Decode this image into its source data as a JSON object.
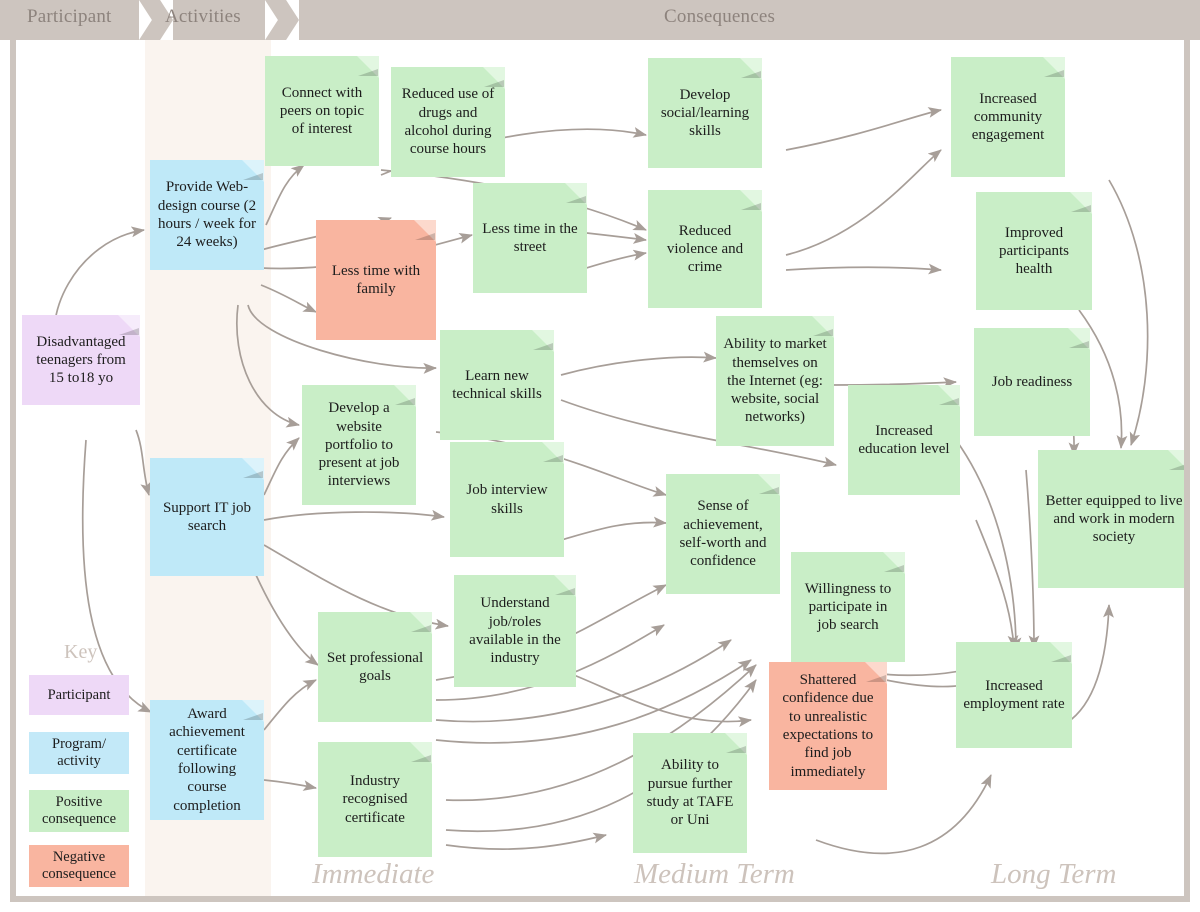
{
  "header": {
    "bands": [
      {
        "label": "Participant"
      },
      {
        "label": "Activities"
      },
      {
        "label": "Consequences"
      }
    ]
  },
  "phase_labels": [
    {
      "label": "Immediate"
    },
    {
      "label": "Medium Term"
    },
    {
      "label": "Long Term"
    }
  ],
  "key": {
    "title": "Key",
    "items": [
      {
        "label": "Participant",
        "color": "#eed9f7"
      },
      {
        "label": "Program/ activity",
        "color": "#c3e9f8"
      },
      {
        "label": "Positive consequence",
        "color": "#c9eec7"
      },
      {
        "label": "Negative consequence",
        "color": "#f9b5a0"
      }
    ]
  },
  "colors": {
    "band": "#cdc5bf",
    "frame": "#cdc5bf",
    "activity_strip": "#faf4ef",
    "arrow": "#a79e98",
    "participant": "#eed9f7",
    "program": "#bfe9f8",
    "positive": "#c9eec7",
    "negative": "#f9b5a0",
    "label_text": "#cdc3bc"
  },
  "nodes": [
    {
      "id": "participant",
      "label": "Disadvantaged teenagers from 15 to18 yo",
      "type": "participant"
    },
    {
      "id": "web-design-course",
      "label": "Provide Web-design course (2 hours / week for 24 weeks)",
      "type": "program"
    },
    {
      "id": "support-it-job-search",
      "label": "Support IT job search",
      "type": "program"
    },
    {
      "id": "award-certificate",
      "label": "Award achievement certificate following course completion",
      "type": "program"
    },
    {
      "id": "connect-with-peers",
      "label": "Connect with peers on topic of interest",
      "type": "positive"
    },
    {
      "id": "reduced-drug-use",
      "label": "Reduced use of  drugs and alcohol during course hours",
      "type": "positive"
    },
    {
      "id": "less-time-street",
      "label": "Less time in the street",
      "type": "positive"
    },
    {
      "id": "less-time-family",
      "label": "Less time with family",
      "type": "negative"
    },
    {
      "id": "learn-technical-skills",
      "label": "Learn new technical skills",
      "type": "positive"
    },
    {
      "id": "website-portfolio",
      "label": "Develop a website portfolio to present at job interviews",
      "type": "positive"
    },
    {
      "id": "job-interview-skills",
      "label": "Job interview skills",
      "type": "positive"
    },
    {
      "id": "understand-job-roles",
      "label": "Understand job/roles available in the industry",
      "type": "positive"
    },
    {
      "id": "set-professional-goals",
      "label": "Set professional goals",
      "type": "positive"
    },
    {
      "id": "industry-certificate",
      "label": "Industry recognised certificate",
      "type": "positive"
    },
    {
      "id": "develop-social-skills",
      "label": "Develop social/learning skills",
      "type": "positive"
    },
    {
      "id": "reduced-violence",
      "label": "Reduced violence and crime",
      "type": "positive"
    },
    {
      "id": "market-themselves",
      "label": "Ability to market themselves on the Internet (eg: website, social networks)",
      "type": "positive"
    },
    {
      "id": "increased-education",
      "label": "Increased education level",
      "type": "positive"
    },
    {
      "id": "sense-of-achievement",
      "label": "Sense of achievement, self-worth and confidence",
      "type": "positive"
    },
    {
      "id": "willingness-job-search",
      "label": "Willingness to participate in job search",
      "type": "positive"
    },
    {
      "id": "shattered-confidence",
      "label": "Shattered confidence due to unrealistic expectations to find job immediately",
      "type": "negative"
    },
    {
      "id": "further-study",
      "label": "Ability to pursue further study at TAFE or Uni",
      "type": "positive"
    },
    {
      "id": "community-engagement",
      "label": "Increased community engagement",
      "type": "positive"
    },
    {
      "id": "improved-health",
      "label": "Improved participants health",
      "type": "positive"
    },
    {
      "id": "job-readiness",
      "label": "Job readiness",
      "type": "positive"
    },
    {
      "id": "better-equipped",
      "label": "Better equipped to live and work in modern society",
      "type": "positive"
    },
    {
      "id": "employment-rate",
      "label": "Increased employment rate",
      "type": "positive"
    }
  ]
}
